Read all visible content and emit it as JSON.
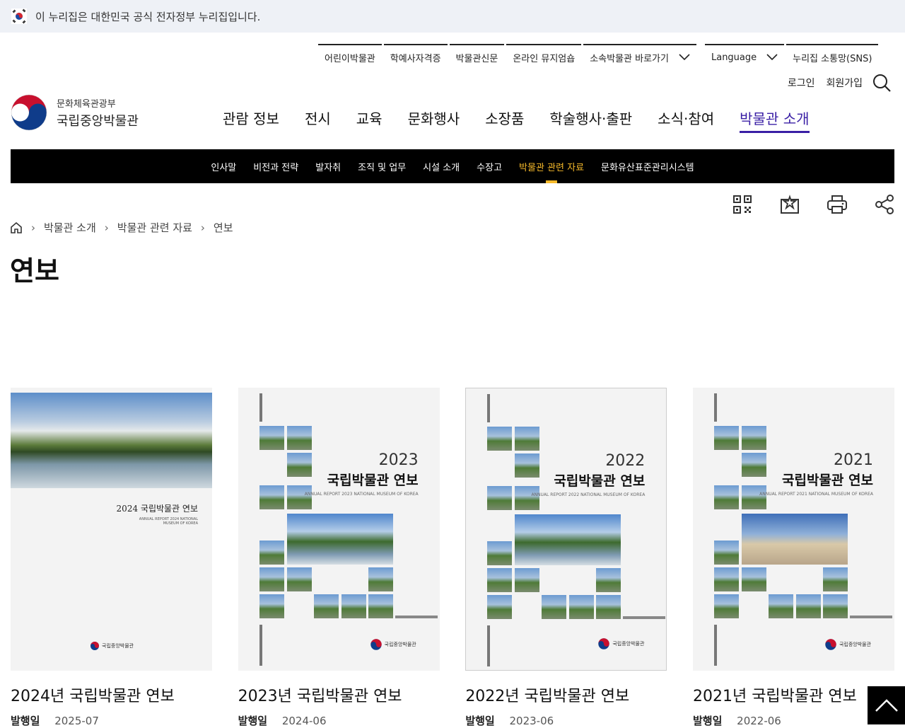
{
  "gov_banner": {
    "text": "이 누리집은 대한민국 공식 전자정부 누리집입니다."
  },
  "util_nav": {
    "items": [
      "어린이박물관",
      "학예사자격증",
      "박물관신문",
      "온라인 뮤지엄숍",
      "소속박물관 바로가기"
    ],
    "language": "Language",
    "sns": "누리집 소통망(SNS)"
  },
  "account": {
    "login": "로그인",
    "signup": "회원가입"
  },
  "logo": {
    "ministry": "문화체육관광부",
    "museum": "국립중앙박물관"
  },
  "main_nav": {
    "items": [
      "관람 정보",
      "전시",
      "교육",
      "문화행사",
      "소장품",
      "학술행사·출판",
      "소식·참여",
      "박물관 소개"
    ],
    "active_index": 7
  },
  "sub_nav": {
    "items": [
      "인사말",
      "비전과 전략",
      "발자취",
      "조직 및 업무",
      "시설 소개",
      "수장고",
      "박물관 관련 자료",
      "문화유산표준관리시스템"
    ],
    "active_index": 6
  },
  "breadcrumb": [
    "박물관 소개",
    "박물관 관련 자료",
    "연보"
  ],
  "page_title": "연보",
  "cards": [
    {
      "title": "2024년 국립박물관 연보",
      "date_label": "발행일",
      "date": "2025-07",
      "cover_text": "2024 국립박물관 연보",
      "cover_sub": "ANNUAL REPORT 2024 NATIONAL MUSEUM OF KOREA",
      "cover_logo": "국립중앙박물관"
    },
    {
      "title": "2023년 국립박물관 연보",
      "date_label": "발행일",
      "date": "2024-06",
      "cover_year": "2023",
      "cover_text": "국립박물관 연보",
      "cover_sub": "ANNUAL REPORT 2023 NATIONAL MUSEUM OF KOREA",
      "cover_logo": "국립중앙박물관"
    },
    {
      "title": "2022년 국립박물관 연보",
      "date_label": "발행일",
      "date": "2023-06",
      "cover_year": "2022",
      "cover_text": "국립박물관 연보",
      "cover_sub": "ANNUAL REPORT 2022 NATIONAL MUSEUM OF KOREA",
      "cover_logo": "국립중앙박물관"
    },
    {
      "title": "2021년 국립박물관 연보",
      "date_label": "발행일",
      "date": "2022-06",
      "cover_year": "2021",
      "cover_text": "국립박물관 연보",
      "cover_sub": "ANNUAL REPORT 2021 NATIONAL MUSEUM OF KOREA",
      "cover_logo": "국립중앙박물관"
    }
  ],
  "colors": {
    "accent": "#3a1fa5",
    "subnav_active": "#f5b92a",
    "subnav_bg": "#000000",
    "gov_bar_bg": "#eef1f6"
  },
  "icons": {
    "qr": "qr-code-icon",
    "bookmark": "bookmark-icon",
    "print": "print-icon",
    "share": "share-icon",
    "home": "home-icon",
    "search": "search-icon",
    "top": "scroll-top-icon"
  }
}
